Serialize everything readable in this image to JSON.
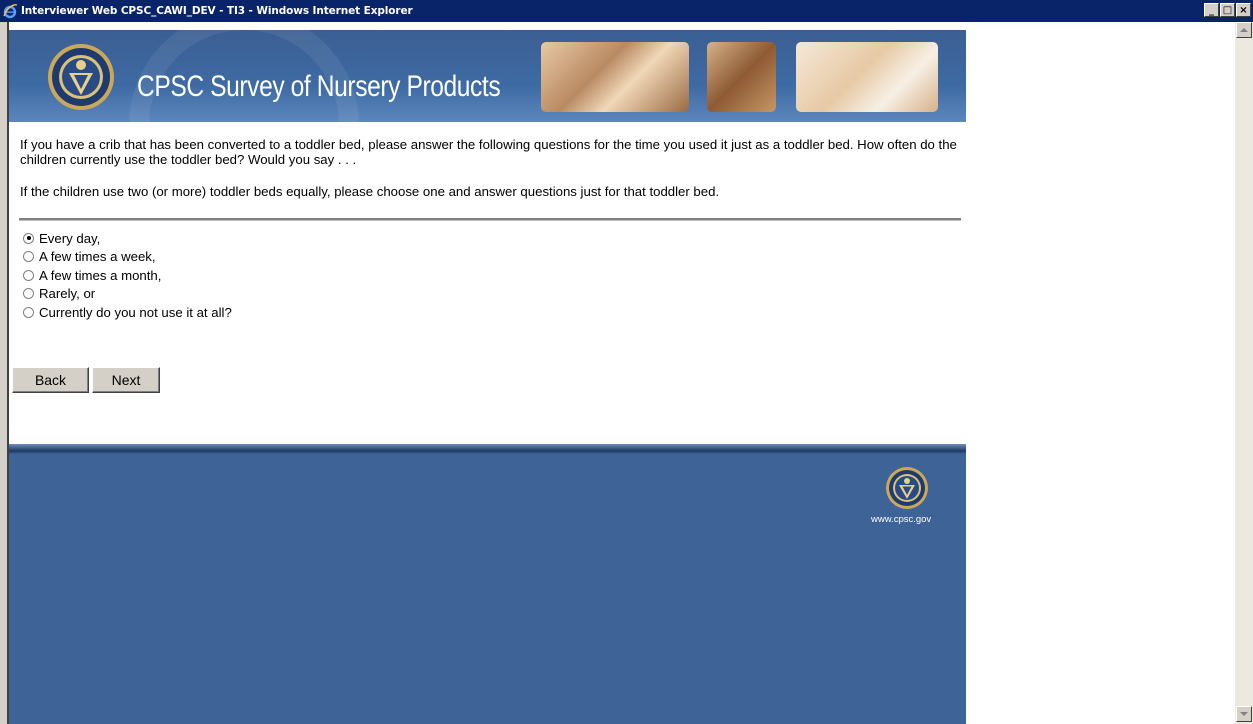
{
  "window": {
    "title": "Interviewer Web CPSC_CAWI_DEV - TI3 - Windows Internet Explorer",
    "buttons": {
      "minimize": "_",
      "maximize": "□",
      "close": "×"
    }
  },
  "banner": {
    "title": "CPSC Survey of Nursery Products"
  },
  "question": {
    "text1": "If you have a crib that has been converted to a toddler bed, please answer the following questions for the time you used it just as a toddler bed. How often do the children currently use the toddler bed? Would you say . . .",
    "text2": "If the children use two (or more) toddler beds equally, please choose one and answer questions just for that toddler bed."
  },
  "options": [
    {
      "label": "Every day,",
      "selected": true
    },
    {
      "label": "A few times a week,",
      "selected": false
    },
    {
      "label": "A few times a month,",
      "selected": false
    },
    {
      "label": "Rarely, or",
      "selected": false
    },
    {
      "label": "Currently do you not use it at all?",
      "selected": false
    }
  ],
  "nav": {
    "back_label": "Back",
    "next_label": "Next"
  },
  "footer": {
    "url": "www.cpsc.gov"
  },
  "colors": {
    "titlebar": "#0a246a",
    "banner": "#3e6aa3",
    "footer": "#3e6397"
  }
}
